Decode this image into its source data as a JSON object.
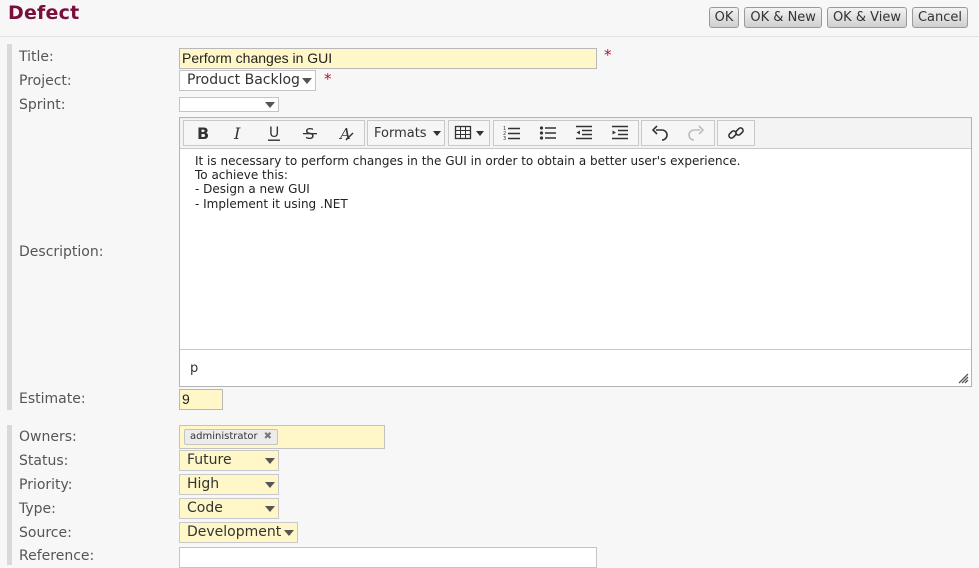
{
  "header": {
    "title": "Defect",
    "buttons": {
      "ok": "OK",
      "ok_new": "OK & New",
      "ok_view": "OK & View",
      "cancel": "Cancel"
    }
  },
  "form": {
    "labels": {
      "title": "Title:",
      "project": "Project:",
      "sprint": "Sprint:",
      "description": "Description:",
      "estimate": "Estimate:",
      "owners": "Owners:",
      "status": "Status:",
      "priority": "Priority:",
      "type": "Type:",
      "source": "Source:",
      "reference": "Reference:"
    },
    "required_mark": "*",
    "title_value": "Perform changes in GUI",
    "project_value": "Product Backlog",
    "sprint_value": "",
    "estimate_value": "9",
    "owners": [
      "administrator"
    ],
    "status_value": "Future",
    "priority_value": "High",
    "type_value": "Code",
    "source_value": "Development",
    "reference_value": ""
  },
  "editor": {
    "toolbar": {
      "formats_label": "Formats",
      "icons": [
        "bold-icon",
        "italic-icon",
        "underline-icon",
        "strikethrough-icon",
        "clear-formatting-icon",
        "table-icon",
        "ordered-list-icon",
        "bullet-list-icon",
        "outdent-icon",
        "indent-icon",
        "undo-icon",
        "redo-icon",
        "link-icon"
      ]
    },
    "content": [
      "It is necessary to perform changes in the GUI in order to obtain a better user's experience.",
      "To achieve this:",
      "- Design a new GUI",
      "- Implement it using .NET"
    ],
    "path": "p"
  },
  "colors": {
    "title": "#7a0f3e",
    "required": "#b0182d",
    "field_highlight": "#fff7c7"
  }
}
